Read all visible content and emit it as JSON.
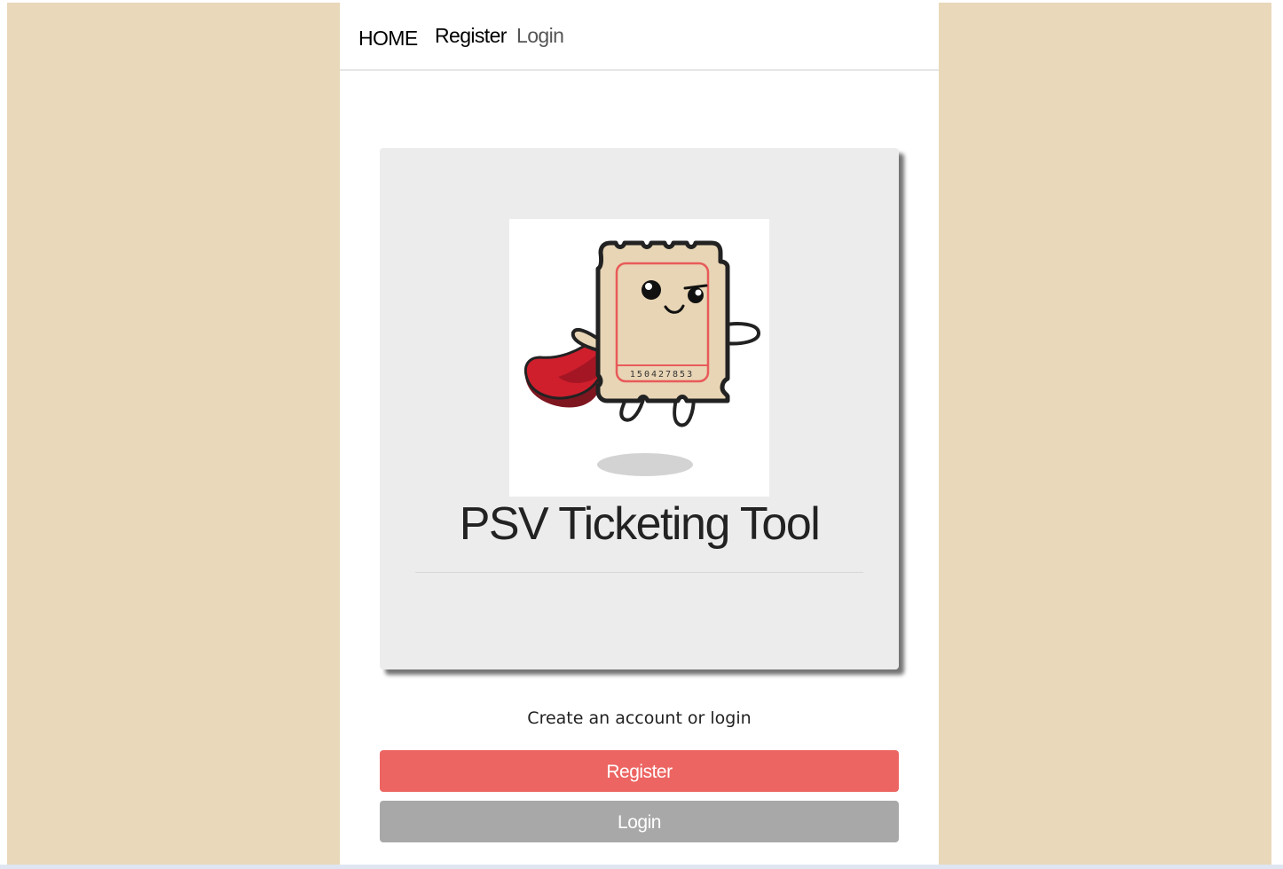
{
  "nav": {
    "home_label": "HOME",
    "register_label": "Register",
    "login_label": "Login"
  },
  "card": {
    "title": "PSV Ticketing Tool",
    "logo": {
      "icon": "ticket-mascot-icon",
      "ticket_number": "150427853"
    }
  },
  "prompt": "Create an account or login",
  "buttons": {
    "register_label": "Register",
    "login_label": "Login"
  },
  "colors": {
    "page_background": "#e9d8b9",
    "register_button": "#ec6562",
    "login_button": "#a8a8a8",
    "card_background": "#ececec"
  }
}
